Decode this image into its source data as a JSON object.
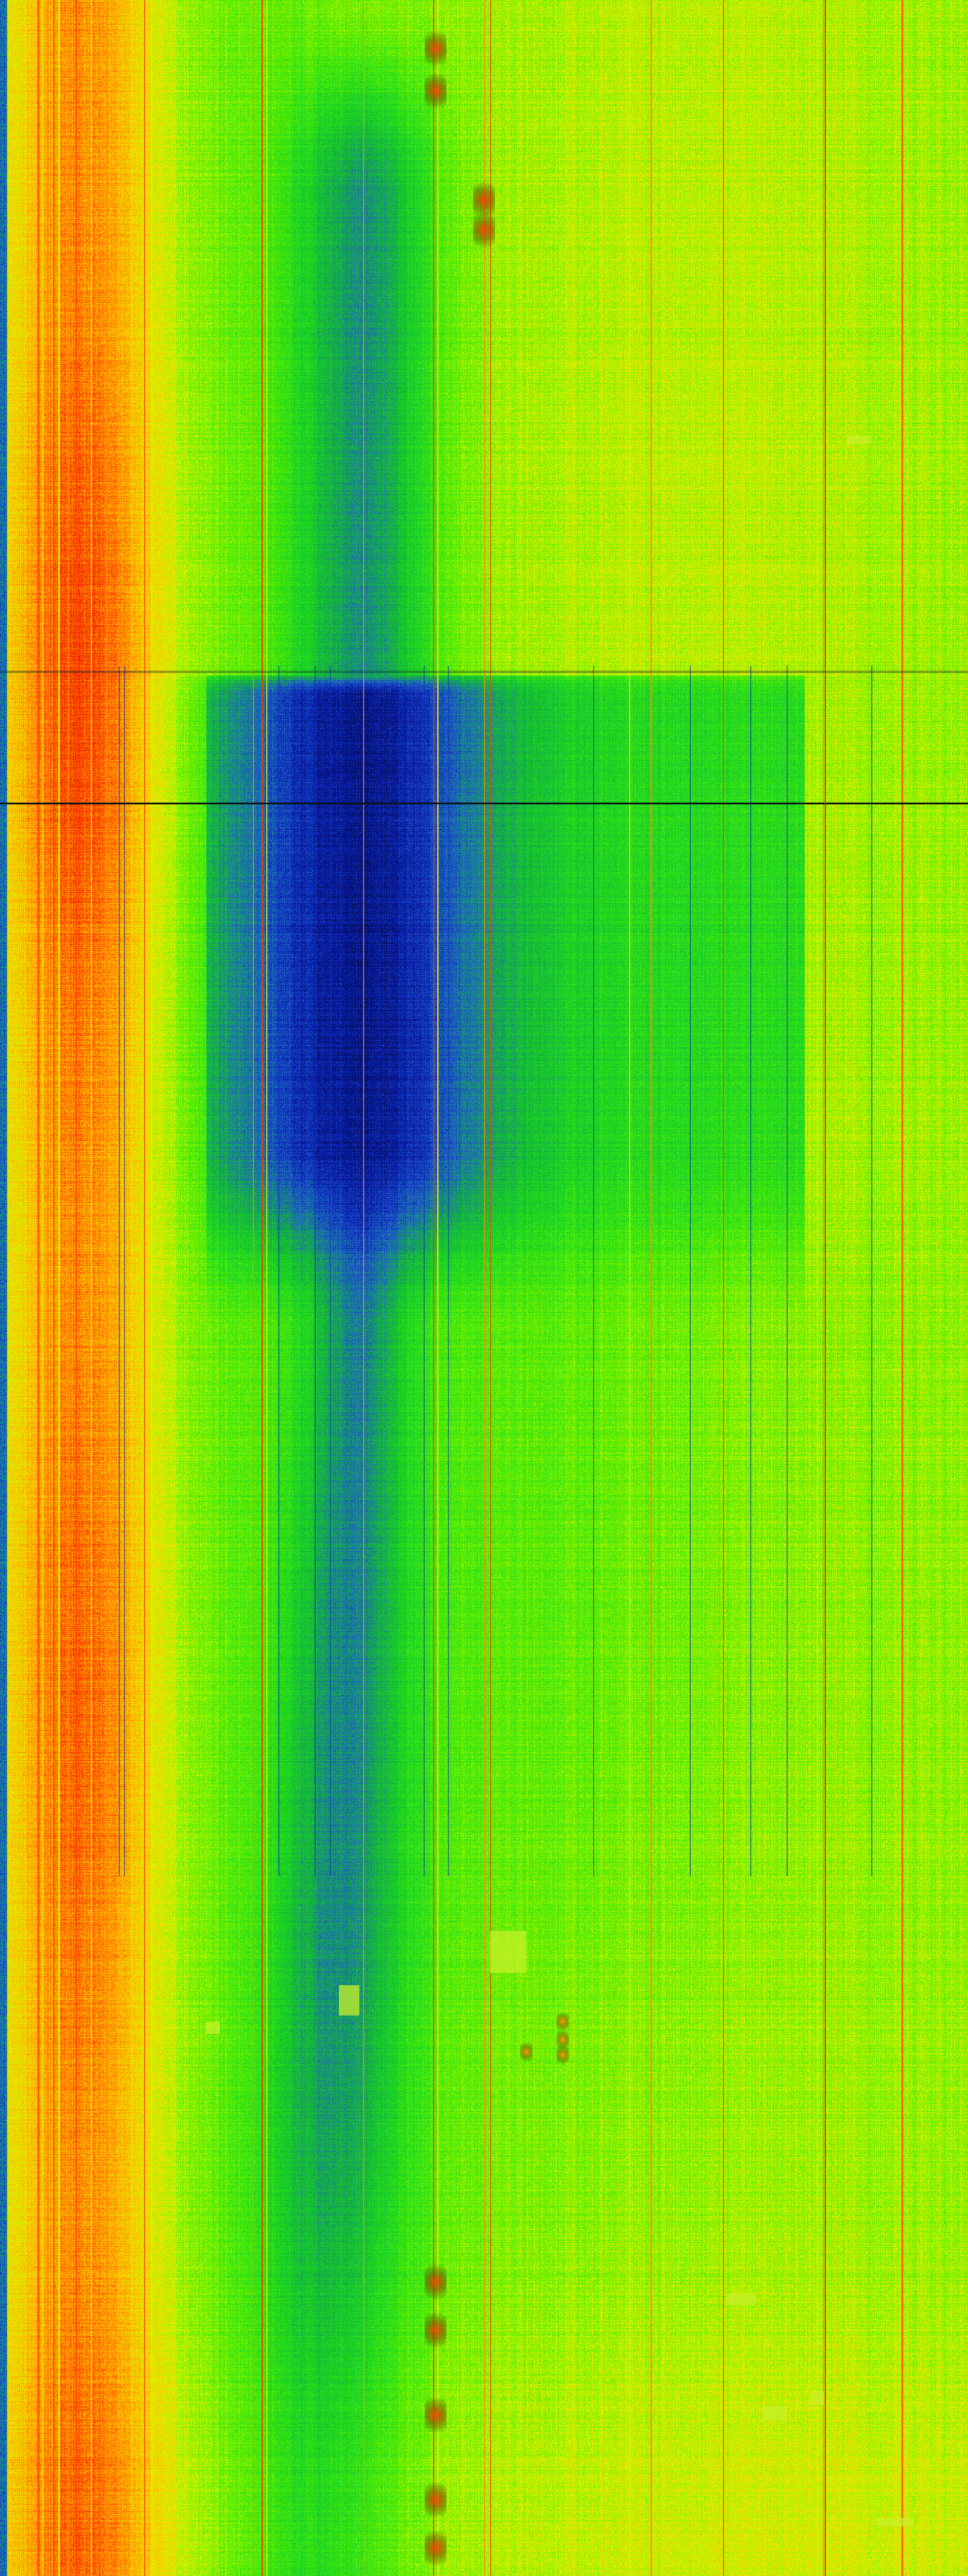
{
  "image": {
    "kind": "waterfall-spectrogram",
    "colormap": {
      "name": "jet-like",
      "stops": [
        "#050a3a",
        "#0a1eb4",
        "#1e64c8",
        "#14b43c",
        "#1edc1e",
        "#64f000",
        "#e6f000",
        "#ffb400",
        "#ff3c00",
        "#c80000"
      ]
    },
    "text": []
  }
}
